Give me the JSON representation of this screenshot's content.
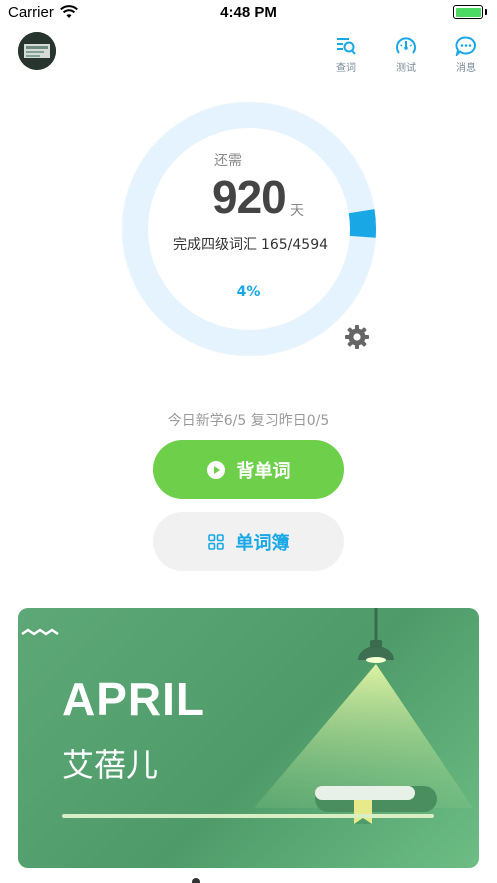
{
  "status_bar": {
    "carrier": "Carrier",
    "time": "4:48 PM"
  },
  "header": {
    "actions": [
      {
        "label": "查词",
        "icon": "search-list-icon"
      },
      {
        "label": "测试",
        "icon": "gauge-icon"
      },
      {
        "label": "消息",
        "icon": "chat-bubble-icon"
      }
    ]
  },
  "progress": {
    "remain_label": "还需",
    "days": "920",
    "days_unit": "天",
    "progress_label": "完成四级词汇",
    "progress_count": "165/4594",
    "percent_text": "4%",
    "completed": 165,
    "total": 4594
  },
  "stats": {
    "text": "今日新学6/5 复习昨日0/5"
  },
  "buttons": {
    "memorize_label": "背单词",
    "wordbook_label": "单词簿"
  },
  "banner": {
    "title": "APRIL",
    "subtitle": "艾蓓儿"
  },
  "colors": {
    "accent_blue": "#1aa7e5",
    "ring_track": "#e4f3fd",
    "primary_green": "#6dcf4a",
    "banner_green": "#4e9b69"
  }
}
